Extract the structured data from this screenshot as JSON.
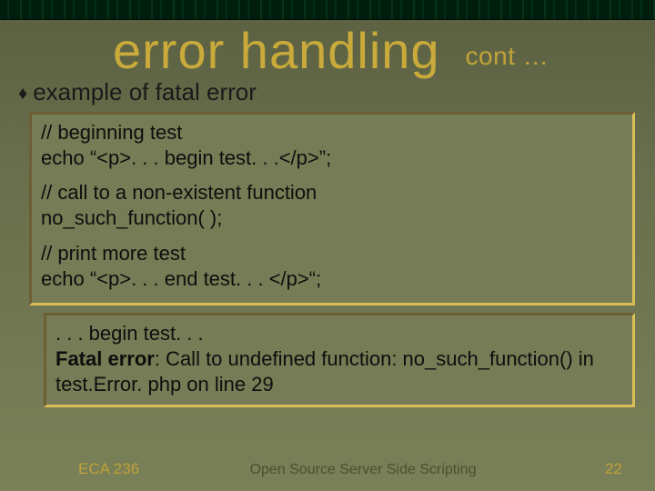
{
  "title": "error handling",
  "cont": "cont …",
  "bullet": "example of fatal error",
  "code": {
    "s1l1": "//  beginning test",
    "s1l2": "echo “<p>. . . begin test. . .</p>”;",
    "s2l1": "//  call to a non-existent function",
    "s2l2": "no_such_function( );",
    "s3l1": "//  print more test",
    "s3l2": "echo “<p>. . . end test. . . </p>“;"
  },
  "output": {
    "l1": ". . . begin test. . .",
    "l2a": "Fatal error",
    "l2b": ": Call to undefined function: no_such_function() in test.Error. php on line 29"
  },
  "footer": {
    "course": "ECA 236",
    "center": "Open Source Server Side Scripting",
    "page": "22"
  }
}
